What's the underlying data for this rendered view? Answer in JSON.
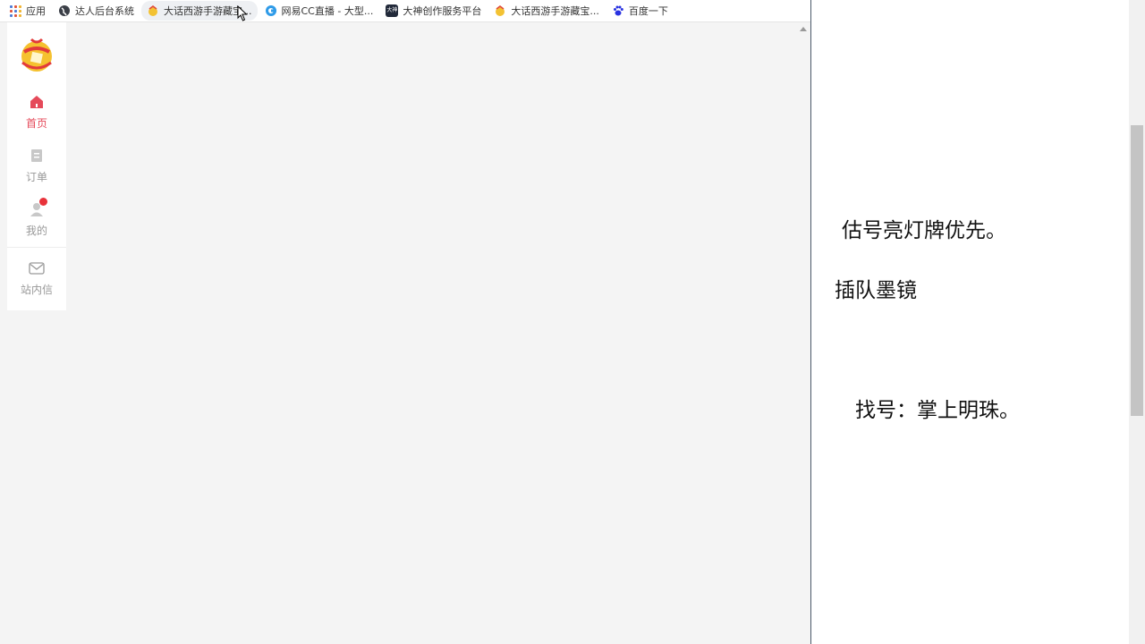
{
  "bookmarks": {
    "apps_label": "应用",
    "items": [
      {
        "label": "达人后台系统",
        "icon": "globe-icon"
      },
      {
        "label": "大话西游手游藏宝...",
        "icon": "game-icon"
      },
      {
        "label": "网易CC直播 - 大型...",
        "icon": "cc-icon"
      },
      {
        "label": "大神创作服务平台",
        "icon": "dashen-icon"
      },
      {
        "label": "大话西游手游藏宝...",
        "icon": "game-icon"
      },
      {
        "label": "百度一下",
        "icon": "baidu-paw-icon"
      }
    ],
    "dashen_badge": "大神"
  },
  "sidebar": {
    "items": [
      {
        "label": "首页",
        "icon": "home-icon",
        "active": true
      },
      {
        "label": "订单",
        "icon": "order-icon",
        "active": false
      },
      {
        "label": "我的",
        "icon": "user-icon",
        "active": false
      },
      {
        "label": "站内信",
        "icon": "mail-icon",
        "active": false
      }
    ]
  },
  "document": {
    "lines": [
      "估号亮灯牌优先。",
      "插队墨镜",
      "找号：掌上明珠。"
    ]
  },
  "colors": {
    "accent": "#e54a5a",
    "badge": "#e8323a",
    "content_bg": "#f4f4f4"
  }
}
